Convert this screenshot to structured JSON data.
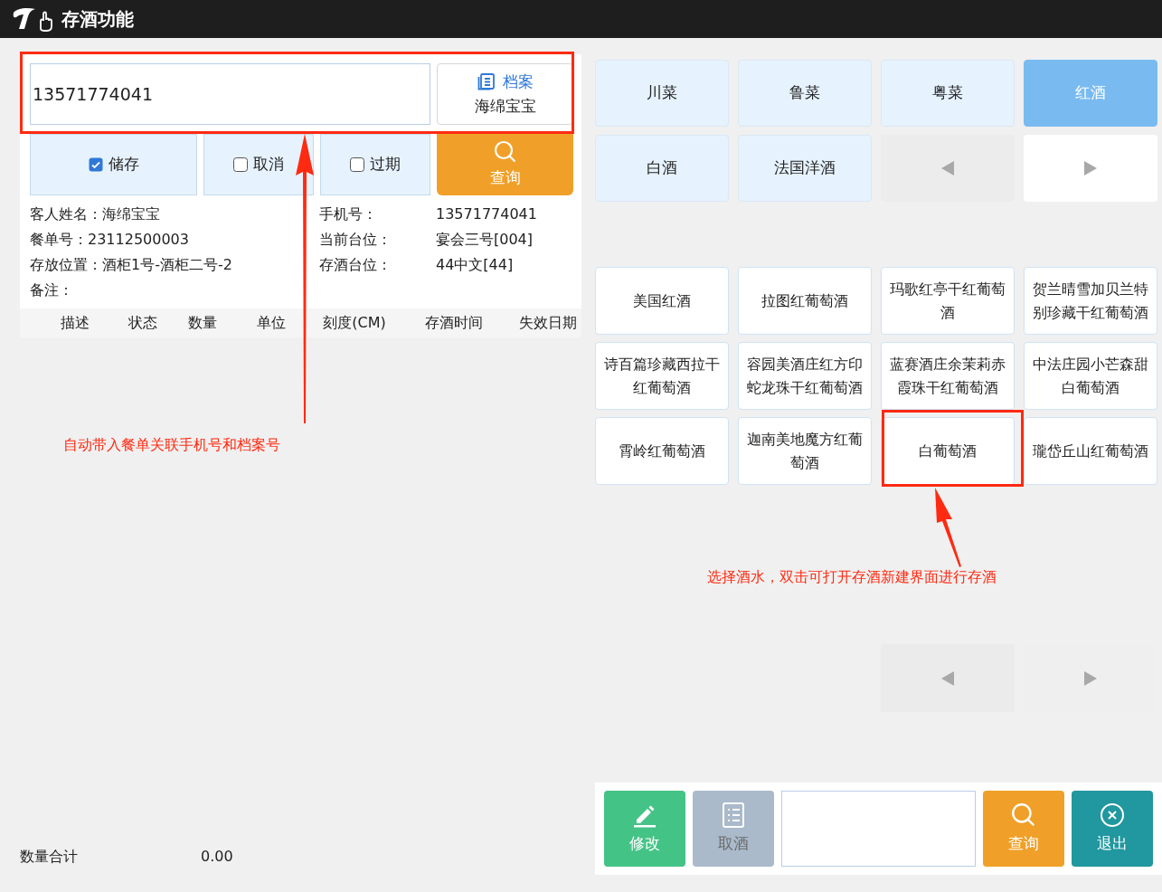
{
  "window": {
    "title": "存酒功能"
  },
  "search": {
    "value": "13571774041",
    "archive_button": {
      "label": "档案",
      "name": "海绵宝宝"
    }
  },
  "filters": [
    {
      "label": "储存",
      "checked": true
    },
    {
      "label": "取消",
      "checked": false
    },
    {
      "label": "过期",
      "checked": false
    }
  ],
  "query_button": {
    "label": "查询"
  },
  "info": {
    "left": [
      {
        "label": "客人姓名：",
        "value": "海绵宝宝"
      },
      {
        "label": "餐单号：",
        "value": "23112500003"
      },
      {
        "label": "存放位置：",
        "value": "酒柜1号-酒柜二号-2"
      },
      {
        "label": "备注："
      }
    ],
    "right": [
      {
        "label": "手机号：",
        "value": "13571774041"
      },
      {
        "label": "当前台位：",
        "value": "宴会三号[004]"
      },
      {
        "label": "存酒台位：",
        "value": "44中文[44]"
      }
    ]
  },
  "table": {
    "columns": [
      "描述",
      "状态",
      "数量",
      "单位",
      "刻度(CM)",
      "存酒时间",
      "失效日期"
    ]
  },
  "summary": {
    "label": "数量合计",
    "value": "0.00"
  },
  "categories": [
    {
      "label": "川菜",
      "selected": false
    },
    {
      "label": "鲁菜",
      "selected": false
    },
    {
      "label": "粤菜",
      "selected": false
    },
    {
      "label": "红酒",
      "selected": true
    },
    {
      "label": "白酒",
      "selected": false
    },
    {
      "label": "法国洋酒",
      "selected": false
    }
  ],
  "category_pager": {
    "prev_disabled": true,
    "next_disabled": false
  },
  "items": [
    {
      "label": "美国红酒"
    },
    {
      "label": "拉图红葡萄酒"
    },
    {
      "label": "玛歌红亭干红葡萄酒"
    },
    {
      "label": "贺兰晴雪加贝兰特别珍藏干红葡萄酒"
    },
    {
      "label": "诗百篇珍藏西拉干红葡萄酒"
    },
    {
      "label": "容园美酒庄红方印蛇龙珠干红葡萄酒"
    },
    {
      "label": "蓝赛酒庄余茉莉赤霞珠干红葡萄酒"
    },
    {
      "label": "中法庄园小芒森甜白葡萄酒"
    },
    {
      "label": "霄岭红葡萄酒"
    },
    {
      "label": "迦南美地魔方红葡萄酒"
    },
    {
      "label": "白葡萄酒"
    },
    {
      "label": "瓏岱丘山红葡萄酒"
    }
  ],
  "toolbar": [
    {
      "kind": "edit",
      "label": "修改"
    },
    {
      "kind": "take",
      "label": "取酒"
    },
    {
      "kind": "field"
    },
    {
      "kind": "search",
      "label": "查询"
    },
    {
      "kind": "exit",
      "label": "退出"
    }
  ],
  "annotations": [
    {
      "kind": "left",
      "text": "自动带入餐单关联手机号和档案号"
    },
    {
      "kind": "right",
      "text": "选择酒水，双击可打开存酒新建界面进行存酒"
    }
  ]
}
